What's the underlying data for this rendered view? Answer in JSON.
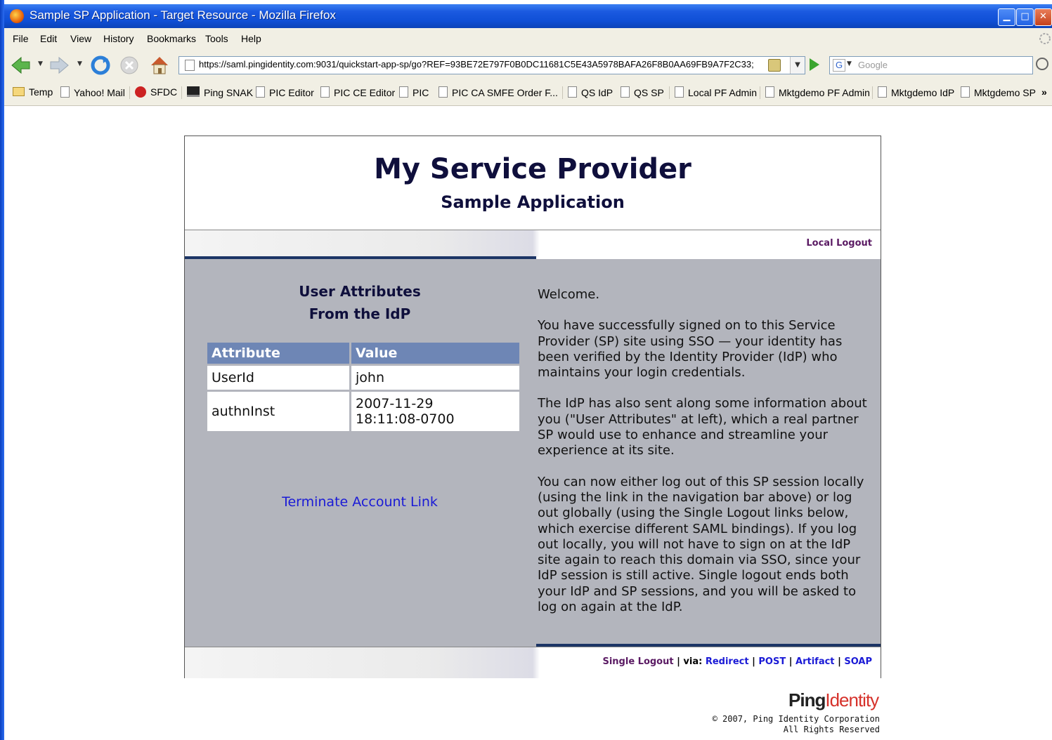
{
  "window": {
    "title": "Sample SP Application - Target Resource - Mozilla Firefox",
    "controls": {
      "minimize": "minimize-icon",
      "maximize": "maximize-icon",
      "close": "close-icon"
    }
  },
  "menu": [
    "File",
    "Edit",
    "View",
    "History",
    "Bookmarks",
    "Tools",
    "Help"
  ],
  "address_bar": {
    "url": "https://saml.pingidentity.com:9031/quickstart-app-sp/go?REF=93BE72E797F0B0DC11681C5E43A5978BAFA26F8B0AA69FB9A7F2C33;",
    "search_placeholder": "Google",
    "search_engine_glyph": "G"
  },
  "bookmarks": [
    "Temp",
    "Yahoo! Mail",
    "SFDC",
    "Ping SNAK",
    "PIC Editor",
    "PIC CE Editor",
    "PIC",
    "PIC CA SMFE Order F...",
    "QS IdP",
    "QS SP",
    "Local PF Admin",
    "Mktgdemo PF Admin",
    "Mktgdemo IdP",
    "Mktgdemo SP",
    "»"
  ],
  "page": {
    "title": "My Service Provider",
    "subtitle": "Sample Application",
    "local_logout": "Local Logout",
    "attributes_title_line1": "User Attributes",
    "attributes_title_line2": "From the IdP",
    "table": {
      "headers": [
        "Attribute",
        "Value"
      ],
      "rows": [
        {
          "attribute": "UserId",
          "value": "john"
        },
        {
          "attribute": "authnInst",
          "value_line1": "2007-11-29",
          "value_line2": "18:11:08-0700"
        }
      ]
    },
    "terminate_link": "Terminate Account Link",
    "welcome": "Welcome.",
    "para1": "You have successfully signed on to this Service Provider (SP) site using SSO — your identity has been verified by the Identity Provider (IdP) who maintains your login credentials.",
    "para2": "The IdP has also sent along some information about you (\"User Attributes\" at left), which a real partner SP would use to enhance and streamline your experience at its site.",
    "para3": "You can now either log out of this SP session locally (using the link in the navigation bar above) or log out globally (using the Single Logout links below, which exercise different SAML bindings). If you log out locally, you will not have to sign on at the IdP site again to reach this domain via SSO, since your IdP session is still active. Single logout ends both your IdP and SP sessions, and you will be asked to log on again at the IdP.",
    "single_logout": "Single Logout",
    "via": "via:",
    "bindings": [
      "Redirect",
      "POST",
      "Artifact",
      "SOAP"
    ],
    "separator": "|"
  },
  "footer": {
    "logo_part1": "Ping",
    "logo_part2": "Identity",
    "copyright": "© 2007, Ping Identity Corporation",
    "rights": "All Rights Reserved"
  },
  "colors": {
    "title_navy": "#0f0f3c",
    "panel_gray": "#b3b5bd",
    "table_header": "#6e86b5",
    "nav_rule": "#1c3566",
    "logout_purple": "#5a1a63",
    "link_blue": "#1a1ad6",
    "logo_red": "#d6322b"
  }
}
